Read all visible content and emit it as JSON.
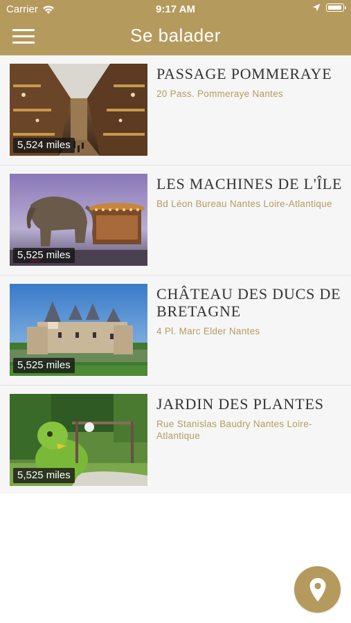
{
  "status_bar": {
    "carrier": "Carrier",
    "time": "9:17 AM"
  },
  "nav": {
    "title": "Se balader",
    "menu_icon": "hamburger-menu-icon"
  },
  "places": [
    {
      "title": "PASSAGE POMMERAYE",
      "address": "20 Pass. Pommeraye Nantes",
      "distance": "5,524 miles"
    },
    {
      "title": "LES MACHINES DE L'ÎLE",
      "address": "Bd Léon Bureau Nantes Loire-Atlantique",
      "distance": "5,525 miles"
    },
    {
      "title": "CHÂTEAU DES DUCS DE BRETAGNE",
      "address": "4 Pl. Marc Elder Nantes",
      "distance": "5,525 miles"
    },
    {
      "title": "JARDIN DES PLANTES",
      "address": "Rue Stanislas Baudry Nantes Loire-Atlantique",
      "distance": "5,525 miles"
    }
  ],
  "fab": {
    "icon": "map-pin-icon"
  },
  "colors": {
    "accent": "#b59a5e",
    "list_background": "#f6f6f6",
    "title_text": "#333333"
  }
}
